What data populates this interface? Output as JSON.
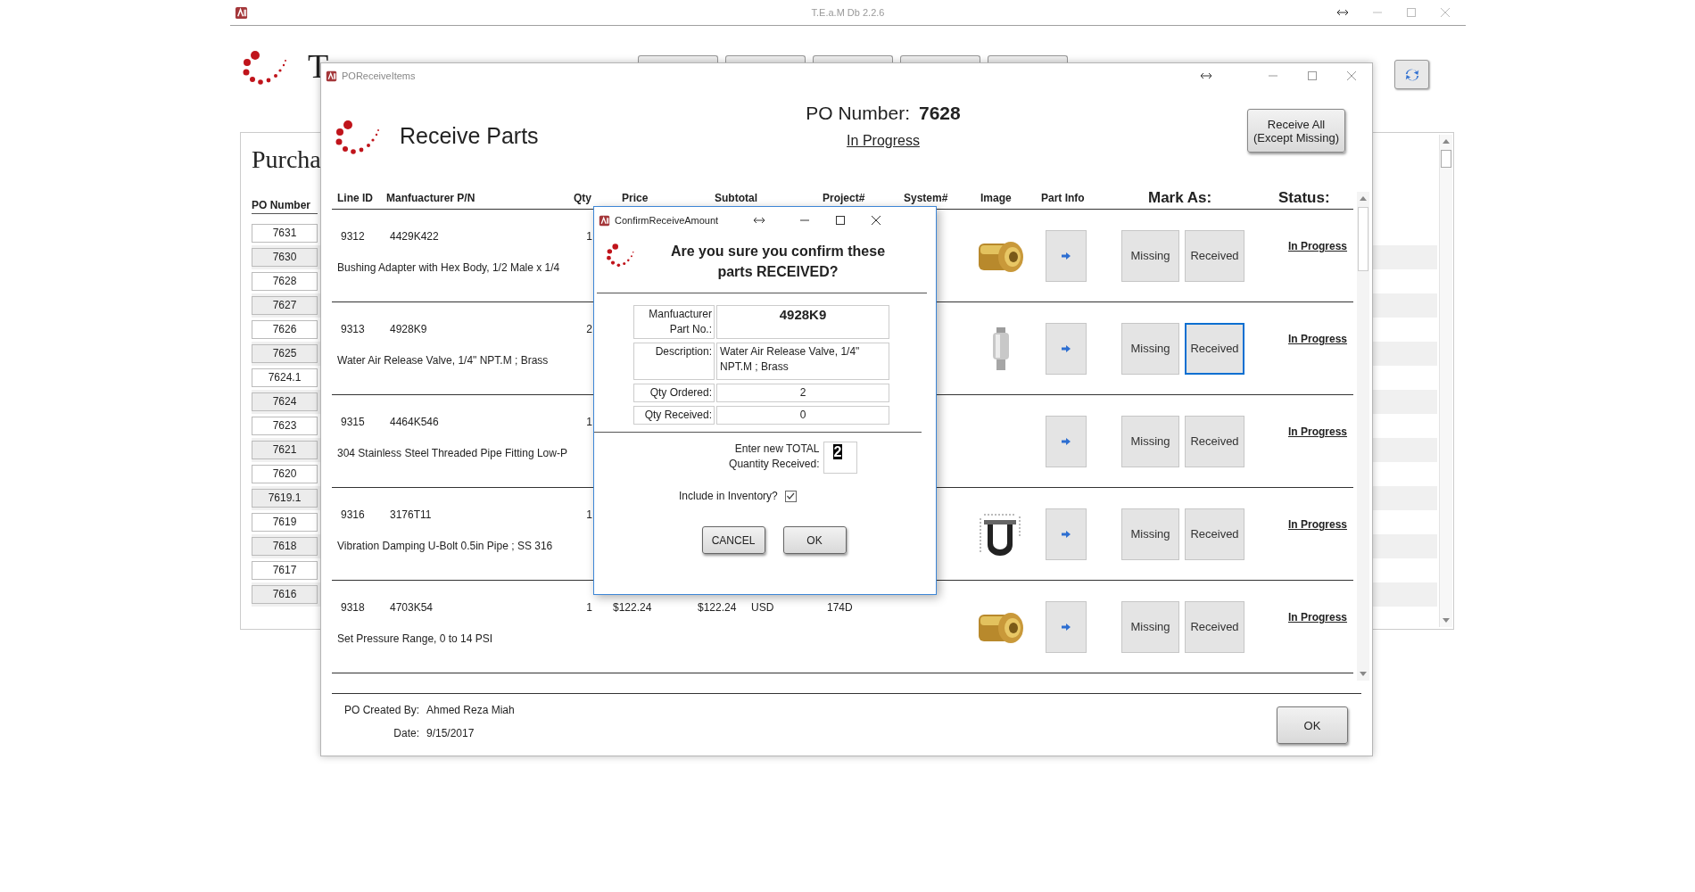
{
  "app_window": {
    "title": "T.E.a.M Db 2.2.6",
    "brand_fragment": "T"
  },
  "po_list": {
    "title": "Purcha",
    "column": "PO Number",
    "rows": [
      "7631",
      "7630",
      "7628",
      "7627",
      "7626",
      "7625",
      "7624.1",
      "7624",
      "7623",
      "7621",
      "7620",
      "7619.1",
      "7619",
      "7618",
      "7617",
      "7616"
    ]
  },
  "receive_window": {
    "title": "POReceiveItems",
    "heading": "Receive Parts",
    "po_label": "PO Number:",
    "po_number": "7628",
    "status": "In Progress",
    "receive_all_button": [
      "Receive All",
      "(Except Missing)"
    ],
    "columns": [
      "Line ID",
      "Manfuacturer P/N",
      "Qty",
      "Price",
      "Subtotal",
      "Project#",
      "System#",
      "Image",
      "Part Info",
      "Mark As:",
      "Status:"
    ],
    "rows": [
      {
        "line_id": "9312",
        "part_no": "4429K422",
        "qty": "1",
        "description": "Bushing Adapter with Hex Body, 1/2 Male x 1/4",
        "image": true,
        "mark_buttons": [
          {
            "label": "Missing",
            "selected": false
          },
          {
            "label": "Received",
            "selected": false
          }
        ],
        "status": "In Progress"
      },
      {
        "line_id": "9313",
        "part_no": "4928K9",
        "qty": "2",
        "description": "Water Air Release Valve, 1/4\" NPT.M ; Brass",
        "image": true,
        "mark_buttons": [
          {
            "label": "Missing",
            "selected": false
          },
          {
            "label": "Received",
            "selected": true
          }
        ],
        "status": "In Progress"
      },
      {
        "line_id": "9315",
        "part_no": "4464K546",
        "qty": "1",
        "description": "304 Stainless Steel Threaded Pipe Fitting Low-P",
        "image": false,
        "mark_buttons": [
          {
            "label": "Missing",
            "selected": false
          },
          {
            "label": "Received",
            "selected": false
          }
        ],
        "status": "In Progress"
      },
      {
        "line_id": "9316",
        "part_no": "3176T11",
        "qty": "1",
        "description": "Vibration Damping U-Bolt 0.5in Pipe ; SS 316",
        "image": true,
        "mark_buttons": [
          {
            "label": "Missing",
            "selected": false
          },
          {
            "label": "Received",
            "selected": false
          }
        ],
        "status": "In Progress"
      },
      {
        "line_id": "9318",
        "part_no": "4703K54",
        "qty": "1",
        "price": "$122.24",
        "subtotal": "$122.24",
        "currency": "USD",
        "project": "174D",
        "description": "Set Pressure Range, 0 to 14 PSI",
        "image": true,
        "mark_buttons": [
          {
            "label": "Missing",
            "selected": false
          },
          {
            "label": "Received",
            "selected": false
          }
        ],
        "status": "In Progress"
      }
    ],
    "footer": {
      "created_by_label": "PO Created By:",
      "created_by": "Ahmed Reza Miah",
      "date_label": "Date:",
      "date": "9/15/2017",
      "ok_button": "OK"
    }
  },
  "dialog": {
    "title": "ConfirmReceiveAmount",
    "question": "Are you sure you confirm these parts RECEIVED?",
    "fields": [
      {
        "label": "Manfuacturer Part No.:",
        "value": "4928K9",
        "kind": "emphasis"
      },
      {
        "label": "Description:",
        "value": "Water Air Release Valve, 1/4\" NPT.M ; Brass",
        "kind": "text"
      },
      {
        "label": "Qty Ordered:",
        "value": "2",
        "kind": "number"
      },
      {
        "label": "Qty Received:",
        "value": "0",
        "kind": "number"
      }
    ],
    "new_total_label": "Enter new TOTAL Quantity Received:",
    "new_total": "2",
    "inventory_label": "Include in Inventory?",
    "include_in_inventory": true,
    "buttons": [
      "CANCEL",
      "OK"
    ]
  }
}
